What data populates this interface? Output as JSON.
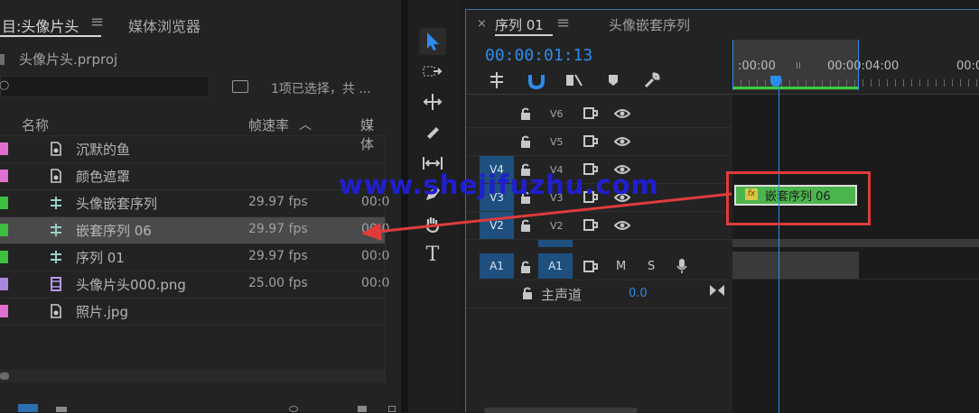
{
  "project_panel": {
    "tab_project": "目:头像片头",
    "tab_media_browser": "媒体浏览器",
    "project_file": "头像片头.prproj",
    "selection_status": "1项已选择，共 ...",
    "columns": {
      "name": "名称",
      "fps": "帧速率",
      "media": "媒体"
    },
    "items": [
      {
        "name": "沉默的鱼",
        "fps": "",
        "media": "",
        "color": "#e070d0",
        "icon": "picture-icon"
      },
      {
        "name": "颜色遮罩",
        "fps": "",
        "media": "",
        "color": "#e070d0",
        "icon": "picture-icon"
      },
      {
        "name": "头像嵌套序列",
        "fps": "29.97 fps",
        "media": "00:0",
        "color": "#3fbf3f",
        "icon": "sequence-icon"
      },
      {
        "name": "嵌套序列 06",
        "fps": "29.97 fps",
        "media": "00:0",
        "color": "#3fbf3f",
        "icon": "sequence-icon",
        "selected": true
      },
      {
        "name": "序列 01",
        "fps": "29.97 fps",
        "media": "00:0",
        "color": "#3fbf3f",
        "icon": "sequence-icon"
      },
      {
        "name": "头像片头000.png",
        "fps": "25.00 fps",
        "media": "00:0",
        "color": "#a889e0",
        "icon": "film-icon"
      },
      {
        "name": "照片.jpg",
        "fps": "",
        "media": "",
        "color": "#e070d0",
        "icon": "picture-icon"
      }
    ]
  },
  "timeline": {
    "tab_sequence": "序列 01",
    "tab_other": "头像嵌套序列",
    "timecode": "00:00:01:13",
    "ruler_labels": [
      ":00:00",
      "00:00:04:00",
      "00:0"
    ],
    "tracks": [
      "V6",
      "V5",
      "V4",
      "V3",
      "V2"
    ],
    "audio_track": "A1",
    "audio_source": "A1",
    "mute": "M",
    "solo": "S",
    "master_label": "主声道",
    "master_value": "0.0",
    "clip_label": "嵌套序列 06",
    "clip_fx": "fx"
  },
  "watermark": "www.shejifuzhu.com",
  "colors": {
    "accent_blue": "#2d8ceb",
    "clip_green": "#4cb44c",
    "annotation_red": "#e03b3b",
    "track_target": "#1f4f7e"
  }
}
